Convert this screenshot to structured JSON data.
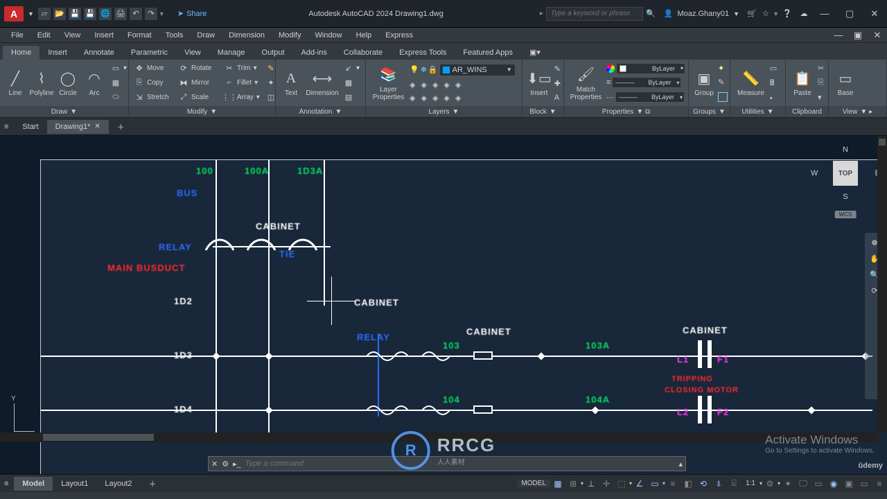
{
  "app": {
    "logo": "A",
    "title": "Autodesk AutoCAD 2024   Drawing1.dwg",
    "share": "Share"
  },
  "search": {
    "placeholder": "Type a keyword or phrase"
  },
  "user": {
    "name": "Moaz.Ghany01"
  },
  "menubar": [
    "File",
    "Edit",
    "View",
    "Insert",
    "Format",
    "Tools",
    "Draw",
    "Dimension",
    "Modify",
    "Window",
    "Help",
    "Express"
  ],
  "ribbon_tabs": [
    "Home",
    "Insert",
    "Annotate",
    "Parametric",
    "View",
    "Manage",
    "Output",
    "Add-ins",
    "Collaborate",
    "Express Tools",
    "Featured Apps"
  ],
  "active_ribbon_tab": "Home",
  "panels": {
    "draw": {
      "label": "Draw",
      "items": {
        "line": "Line",
        "polyline": "Polyline",
        "circle": "Circle",
        "arc": "Arc"
      }
    },
    "modify": {
      "label": "Modify",
      "rows": [
        {
          "a": "Move",
          "b": "Rotate",
          "c": "Trim"
        },
        {
          "a": "Copy",
          "b": "Mirror",
          "c": "Fillet"
        },
        {
          "a": "Stretch",
          "b": "Scale",
          "c": "Array"
        }
      ]
    },
    "annotation": {
      "label": "Annotation",
      "text": "Text",
      "dimension": "Dimension"
    },
    "layers": {
      "label": "Layers",
      "lp": "Layer\nProperties",
      "current": "AR_WINS"
    },
    "block": {
      "label": "Block",
      "insert": "Insert"
    },
    "properties": {
      "label": "Properties",
      "mp": "Match\nProperties",
      "bylayer": "ByLayer"
    },
    "groups": {
      "label": "Groups",
      "group": "Group"
    },
    "utilities": {
      "label": "Utilities",
      "measure": "Measure"
    },
    "clipboard": {
      "label": "Clipboard",
      "paste": "Paste"
    },
    "view": {
      "label": "View",
      "base": "Base"
    }
  },
  "filetabs": {
    "start": "Start",
    "drawing": "Drawing1*"
  },
  "viewcube": {
    "top": "TOP",
    "n": "N",
    "s": "S",
    "e": "E",
    "w": "W",
    "wcs": "WCS"
  },
  "ucs": {
    "y": "Y"
  },
  "cmd": {
    "placeholder": "Type a command"
  },
  "activate": {
    "l1": "Activate Windows",
    "l2": "Go to Settings to activate Windows."
  },
  "layouttabs": {
    "model": "Model",
    "l1": "Layout1",
    "l2": "Layout2"
  },
  "status": {
    "model": "MODEL",
    "scale": "1:1"
  },
  "drawing_text": {
    "cabinet1": "CABINET",
    "cabinet2": "CABINET",
    "cabinet3": "CABINET",
    "cabinet4": "CABINET",
    "id2": "1D2",
    "id3": "1D3",
    "id4": "1D4",
    "g103": "103",
    "g104": "104",
    "g103a": "103A",
    "g104a": "104A",
    "main": "MAIN BUSDUCT",
    "closing": "CLOSING",
    "motor": "MOTOR",
    "trip": "TRIPPING",
    "l2": "L2",
    "l1": "L1",
    "f1": "F1",
    "f2": "F2"
  },
  "watermark": {
    "main": "RRCG",
    "sub": "人人素材"
  }
}
